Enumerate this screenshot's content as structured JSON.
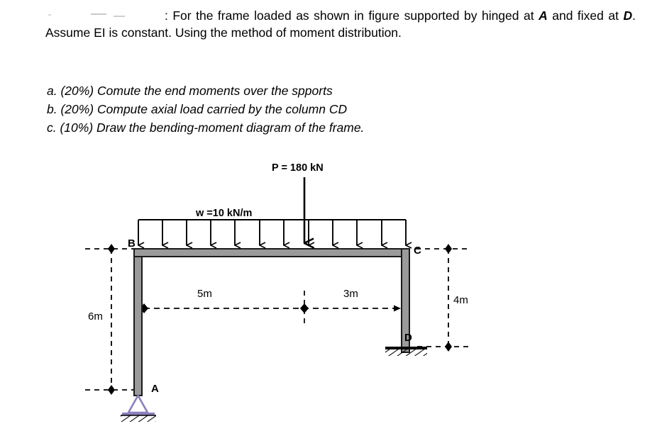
{
  "statement": {
    "prefix_obscured": "",
    "line_main": ": For the frame loaded as shown in figure supported by hinged at ",
    "node_a": "A",
    "mid": " and fixed at ",
    "node_d": "D",
    "tail": ". Assume EI is constant. Using the method of moment distribution."
  },
  "questions": [
    "a. (20%) Comute the end moments over the spports",
    "b. (20%) Compute axial load carried by the column CD",
    "c. (10%) Draw the bending-moment diagram of the frame."
  ],
  "figure": {
    "point_load_label": "P = 180 kN",
    "udl_label": "w =10 kN/m",
    "joints": {
      "a": "A",
      "b": "B",
      "c": "C",
      "d": "D"
    },
    "dimensions": {
      "left_height": "6m",
      "span_left": "5m",
      "span_right": "3m",
      "right_height": "4m"
    },
    "colors": {
      "member_fill": "#9a9a9a",
      "member_stroke": "#1a1a1a",
      "hinge": "#8c7fbd",
      "dimension": "#000000"
    },
    "udl_arrow_count": 12,
    "support_a_type": "hinged",
    "support_d_type": "fixed"
  },
  "chart_data": {
    "type": "diagram",
    "title": "Rigid frame — moment distribution problem",
    "members": [
      {
        "name": "AB",
        "from": "A",
        "to": "B",
        "orientation": "vertical",
        "length_m": 6
      },
      {
        "name": "BC",
        "from": "B",
        "to": "C",
        "orientation": "horizontal",
        "length_m": 8
      },
      {
        "name": "CD",
        "from": "C",
        "to": "D",
        "orientation": "vertical",
        "length_m": 4
      }
    ],
    "loads": [
      {
        "type": "point",
        "label": "P = 180 kN",
        "magnitude_kN": 180,
        "on_member": "BC",
        "distance_from_B_m": 5,
        "direction": "down"
      },
      {
        "type": "udl",
        "label": "w =10 kN/m",
        "magnitude_kN_per_m": 10,
        "on_member": "BC",
        "extent_m": 8,
        "direction": "down"
      }
    ],
    "supports": [
      {
        "node": "A",
        "type": "hinged"
      },
      {
        "node": "D",
        "type": "fixed"
      }
    ]
  }
}
